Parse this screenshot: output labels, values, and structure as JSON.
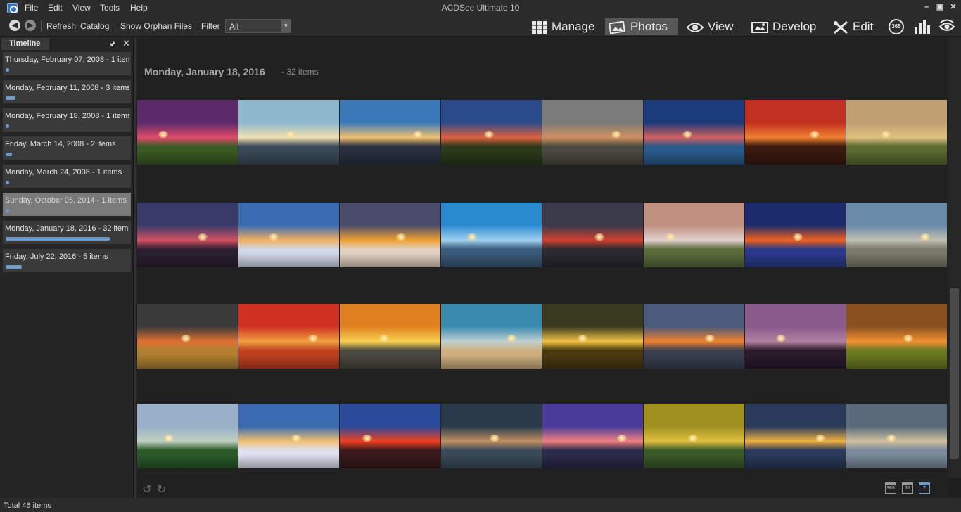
{
  "window": {
    "title": "ACDSee Ultimate 10",
    "minimize": "–",
    "restore": "▣",
    "close": "✕"
  },
  "menu": [
    "File",
    "Edit",
    "View",
    "Tools",
    "Help"
  ],
  "toolbar": {
    "back_glyph": "◀",
    "forward_glyph": "▶",
    "refresh": "Refresh",
    "catalog": "Catalog",
    "show_orphan_files": "Show Orphan Files",
    "filter_label": "Filter",
    "filter_value": "All"
  },
  "modes": {
    "manage": "Manage",
    "photos": "Photos",
    "view": "View",
    "develop": "Develop",
    "edit": "Edit",
    "active": "Photos",
    "icon_365": "365"
  },
  "timeline": {
    "tab_label": "Timeline",
    "pin_glyph": "🖈",
    "close_glyph": "✕",
    "items": [
      {
        "label": "Thursday, February 07, 2008 - 1 items",
        "count": 1,
        "selected": false
      },
      {
        "label": "Monday, February 11, 2008 - 3 items",
        "count": 3,
        "selected": false
      },
      {
        "label": "Monday, February 18, 2008 - 1 items",
        "count": 1,
        "selected": false
      },
      {
        "label": "Friday, March 14, 2008 - 2 items",
        "count": 2,
        "selected": false
      },
      {
        "label": "Monday, March 24, 2008 - 1 items",
        "count": 1,
        "selected": false
      },
      {
        "label": "Sunday, October 05, 2014 - 1 items",
        "count": 1,
        "selected": true
      },
      {
        "label": "Monday, January 18, 2016 - 32 items",
        "count": 32,
        "selected": false
      },
      {
        "label": "Friday, July 22, 2016 - 5 items",
        "count": 5,
        "selected": false
      }
    ]
  },
  "group": {
    "date": "Monday, January 18, 2016",
    "count": "- 32 items"
  },
  "thumbnails": [
    {
      "name": "sunset-meadow-pink-sky",
      "sky": "#5a2a6b",
      "horizon": "#e04a6a",
      "ground": "#3a5a24"
    },
    {
      "name": "misty-lake-pine-sunrise",
      "sky": "#8fb8cf",
      "horizon": "#f0e0b0",
      "ground": "#3a4a5a"
    },
    {
      "name": "rocky-shore-sunburst",
      "sky": "#3a78b8",
      "horizon": "#f0c070",
      "ground": "#2a3040"
    },
    {
      "name": "fiery-clouds-treeline",
      "sky": "#2a4a8a",
      "horizon": "#e06040",
      "ground": "#2a3a1a"
    },
    {
      "name": "tidal-stream-dusk",
      "sky": "#7a7a7a",
      "horizon": "#d09060",
      "ground": "#4a4a40"
    },
    {
      "name": "blue-lake-jetty",
      "sky": "#1a3a7a",
      "horizon": "#d06060",
      "ground": "#2a5a8a"
    },
    {
      "name": "red-sea-stacks-sunset",
      "sky": "#c03020",
      "horizon": "#f08030",
      "ground": "#3a1a10"
    },
    {
      "name": "white-car-country-road",
      "sky": "#c0a070",
      "horizon": "#e0c080",
      "ground": "#5a6a30"
    },
    {
      "name": "purple-clouds-twilight",
      "sky": "#3a3a6a",
      "horizon": "#d05060",
      "ground": "#2a2030"
    },
    {
      "name": "snowy-cabin-sunburst",
      "sky": "#3a6ab0",
      "horizon": "#f0b060",
      "ground": "#d0d8e8"
    },
    {
      "name": "lone-tree-snow-sunset",
      "sky": "#4a4a6a",
      "horizon": "#f0a030",
      "ground": "#e0d0c0"
    },
    {
      "name": "blue-bridge-fog",
      "sky": "#2a8ad0",
      "horizon": "#a0d0f0",
      "ground": "#3a5a7a"
    },
    {
      "name": "red-sky-reflection-pier",
      "sky": "#3a3a4a",
      "horizon": "#d04030",
      "ground": "#2a2a30"
    },
    {
      "name": "alpine-peaks-meadow",
      "sky": "#c09080",
      "horizon": "#e0d0d0",
      "ground": "#5a6a3a"
    },
    {
      "name": "blue-snow-sunset-glow",
      "sky": "#1a2a6a",
      "horizon": "#f06020",
      "ground": "#2a3a8a"
    },
    {
      "name": "bare-trees-frost-field",
      "sky": "#6a8aaa",
      "horizon": "#c0c0b0",
      "ground": "#7a7a6a"
    },
    {
      "name": "golden-wheat-storm",
      "sky": "#3a3a3a",
      "horizon": "#e07030",
      "ground": "#b08030"
    },
    {
      "name": "orange-sky-desert-flowers",
      "sky": "#d03020",
      "horizon": "#f0a040",
      "ground": "#c04020"
    },
    {
      "name": "yellow-sun-ocean",
      "sky": "#e08020",
      "horizon": "#f8d050",
      "ground": "#4a4a40"
    },
    {
      "name": "beach-tree-chairs",
      "sky": "#3a8ab0",
      "horizon": "#c0d0d0",
      "ground": "#d0b080"
    },
    {
      "name": "tree-silhouette-golden-road",
      "sky": "#3a3a20",
      "horizon": "#f0c040",
      "ground": "#4a3a10"
    },
    {
      "name": "ocean-sunset-clouds",
      "sky": "#4a5a7a",
      "horizon": "#f08030",
      "ground": "#3a4050"
    },
    {
      "name": "tree-row-reflection",
      "sky": "#8a5a8a",
      "horizon": "#b080a0",
      "ground": "#2a1a2a"
    },
    {
      "name": "sunset-green-field",
      "sky": "#8a5020",
      "horizon": "#f09030",
      "ground": "#6a7a20"
    },
    {
      "name": "green-river-valley",
      "sky": "#9ab0c8",
      "horizon": "#c0d0c0",
      "ground": "#2a5a2a"
    },
    {
      "name": "snow-village-sunrays",
      "sky": "#3a6ab0",
      "horizon": "#f0c070",
      "ground": "#e0e0f0"
    },
    {
      "name": "red-road-sunset-forest",
      "sky": "#2a4a9a",
      "horizon": "#f04020",
      "ground": "#3a1a1a"
    },
    {
      "name": "storm-rocks-ocean",
      "sky": "#2a3a4a",
      "horizon": "#c09060",
      "ground": "#3a4a5a"
    },
    {
      "name": "violet-dusk-frost-field",
      "sky": "#4a3a9a",
      "horizon": "#f08080",
      "ground": "#2a2a4a"
    },
    {
      "name": "green-barn-lake",
      "sky": "#a09020",
      "horizon": "#e0c040",
      "ground": "#3a5a2a"
    },
    {
      "name": "golden-coast-rocks",
      "sky": "#2a3a5a",
      "horizon": "#f0b040",
      "ground": "#2a3a5a"
    },
    {
      "name": "sunbeam-clouds-sea",
      "sky": "#5a6a7a",
      "horizon": "#d0c0a0",
      "ground": "#7a8a9a"
    }
  ],
  "status": {
    "total": "Total 46 items"
  },
  "bottom": {
    "rotate_left": "↺",
    "rotate_right": "↻",
    "cal_year": "365",
    "cal_month": "31",
    "cal_week": "7"
  }
}
